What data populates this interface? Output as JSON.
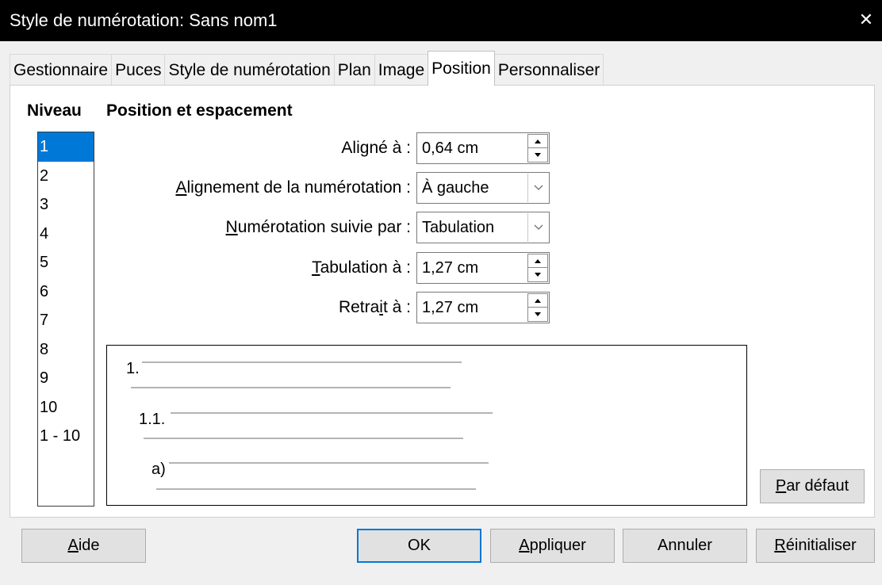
{
  "window": {
    "title": "Style de numérotation: Sans nom1",
    "close_symbol": "✕"
  },
  "tabs": [
    {
      "label": "Gestionnaire",
      "active": false
    },
    {
      "label": "Puces",
      "active": false
    },
    {
      "label": "Style de numérotation",
      "active": false
    },
    {
      "label": "Plan",
      "active": false
    },
    {
      "label": "Image",
      "active": false
    },
    {
      "label": "Position",
      "active": true
    },
    {
      "label": "Personnaliser",
      "active": false
    }
  ],
  "level_section": {
    "title": "Niveau",
    "levels": [
      "1",
      "2",
      "3",
      "4",
      "5",
      "6",
      "7",
      "8",
      "9",
      "10",
      "1 - 10"
    ],
    "selected": "1"
  },
  "position_section": {
    "title": "Position et espacement",
    "aligned_at": {
      "label_pre": "Ali",
      "label_key": "g",
      "label_post": "né à :",
      "value": "0,64 cm"
    },
    "numbering_alignment": {
      "label_pre": "",
      "label_key": "A",
      "label_post": "lignement de la numérotation :",
      "value": "À gauche"
    },
    "numbering_followed_by": {
      "label_pre": "",
      "label_key": "N",
      "label_post": "umérotation suivie par :",
      "value": "Tabulation"
    },
    "tab_stop_at": {
      "label_pre": "",
      "label_key": "T",
      "label_post": "abulation à :",
      "value": "1,27 cm"
    },
    "indent_at": {
      "label_pre": "Retra",
      "label_key": "i",
      "label_post": "t à :",
      "value": "1,27 cm"
    }
  },
  "preview": {
    "labels": [
      "1.",
      "1.1.",
      "a)"
    ]
  },
  "buttons": {
    "default_pre": "",
    "default_key": "P",
    "default_post": "ar défaut",
    "help_pre": "",
    "help_key": "A",
    "help_post": "ide",
    "ok": "OK",
    "apply_pre": "",
    "apply_key": "A",
    "apply_post": "ppliquer",
    "cancel": "Annuler",
    "reset_pre": "",
    "reset_key": "R",
    "reset_post": "éinitialiser"
  },
  "icons": {
    "spin_up": "triangle-up",
    "spin_down": "triangle-down",
    "dropdown": "chevron-down"
  }
}
